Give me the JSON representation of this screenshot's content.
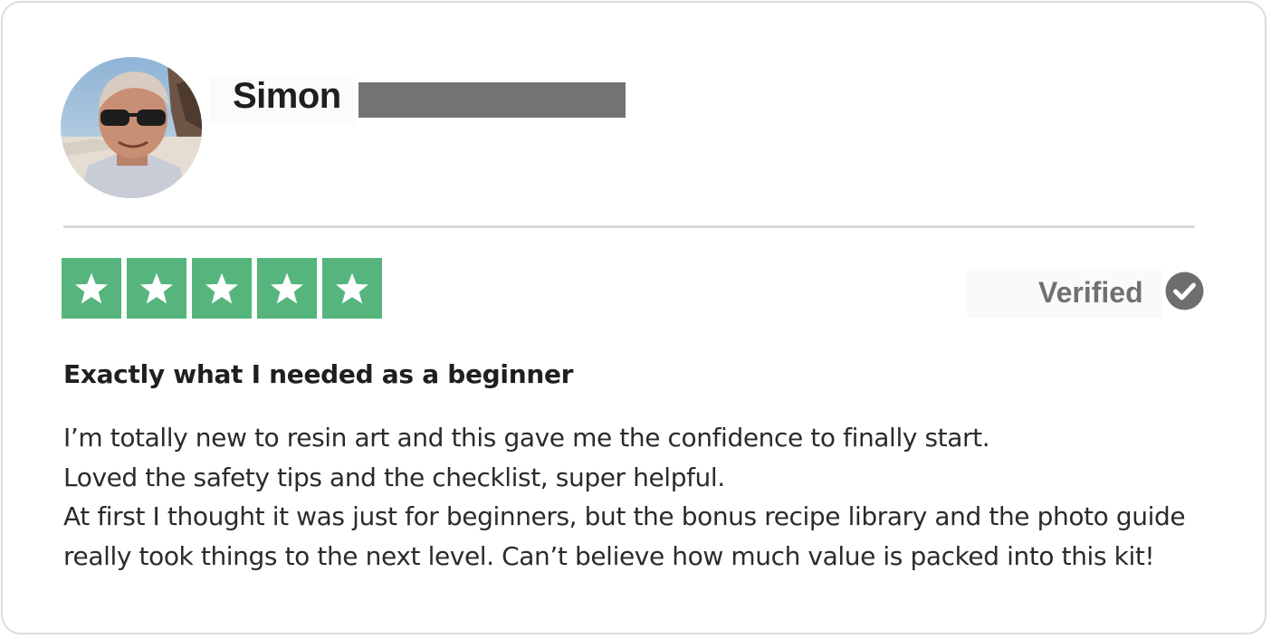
{
  "reviewer": {
    "name": "Simon",
    "avatar_icon": "profile-photo"
  },
  "rating": {
    "stars": 5,
    "max": 5,
    "color": "#55b57d"
  },
  "verification": {
    "label": "Verified",
    "icon": "check-circle-icon"
  },
  "review": {
    "title": "Exactly what I needed as a beginner",
    "lines": [
      "I’m totally new to resin art and this gave me the confidence to finally start.",
      "Loved the safety tips and the checklist, super helpful.",
      "At first I thought it was just for beginners, but the bonus recipe library and the photo guide",
      "really took things to the next level. Can’t believe how much value is packed into this kit!"
    ]
  }
}
